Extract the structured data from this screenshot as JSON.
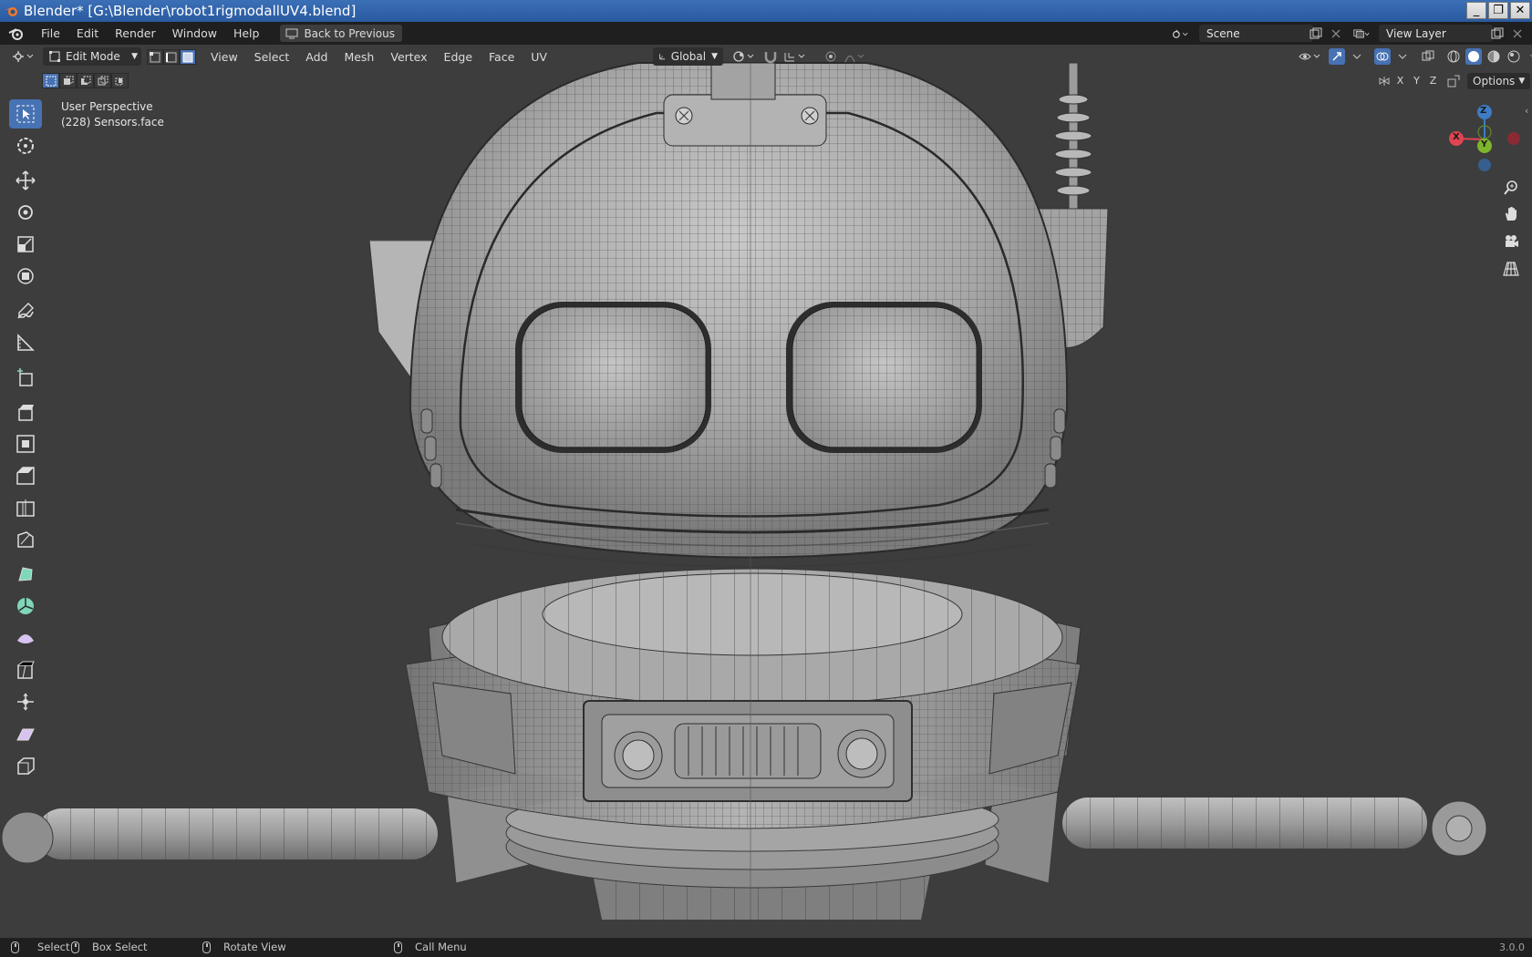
{
  "window": {
    "title": "Blender* [G:\\Blender\\robot1rigmodallUV4.blend]",
    "buttons": {
      "minimize": "_",
      "maximize": "❐",
      "close": "✕"
    }
  },
  "topbar": {
    "menus": [
      "File",
      "Edit",
      "Render",
      "Window",
      "Help"
    ],
    "back_to_previous": "Back to Previous",
    "scene": "Scene",
    "view_layer": "View Layer"
  },
  "viewport_header": {
    "mode": "Edit Mode",
    "menus": [
      "View",
      "Select",
      "Add",
      "Mesh",
      "Vertex",
      "Edge",
      "Face",
      "UV"
    ],
    "transform_orientation": "Global",
    "select_modes": [
      "vertex",
      "edge",
      "face"
    ],
    "active_select_mode": "face"
  },
  "viewport": {
    "perspective": "User Perspective",
    "object_info": "(228) Sensors.face",
    "axis_buttons": [
      "X",
      "Y",
      "Z"
    ],
    "options_label": "Options",
    "gizmo": {
      "x": "X",
      "y": "Y",
      "z": "Z"
    },
    "colors": {
      "x": "#e04450",
      "y": "#7eb52a",
      "z": "#3d7cc4",
      "selected": "#4772b3"
    }
  },
  "toolbar": {
    "tools": [
      "select-box",
      "cursor",
      "move",
      "rotate",
      "scale",
      "transform",
      "annotate",
      "measure",
      "add-cube",
      "extrude",
      "inset",
      "bevel",
      "loop-cut",
      "knife",
      "poly-build",
      "spin",
      "smooth",
      "edge-slide",
      "shrink-fatten",
      "shear",
      "rip-region"
    ]
  },
  "statusbar": {
    "select": "Select",
    "box_select": "Box Select",
    "rotate_view": "Rotate View",
    "call_menu": "Call Menu",
    "version": "3.0.0"
  }
}
